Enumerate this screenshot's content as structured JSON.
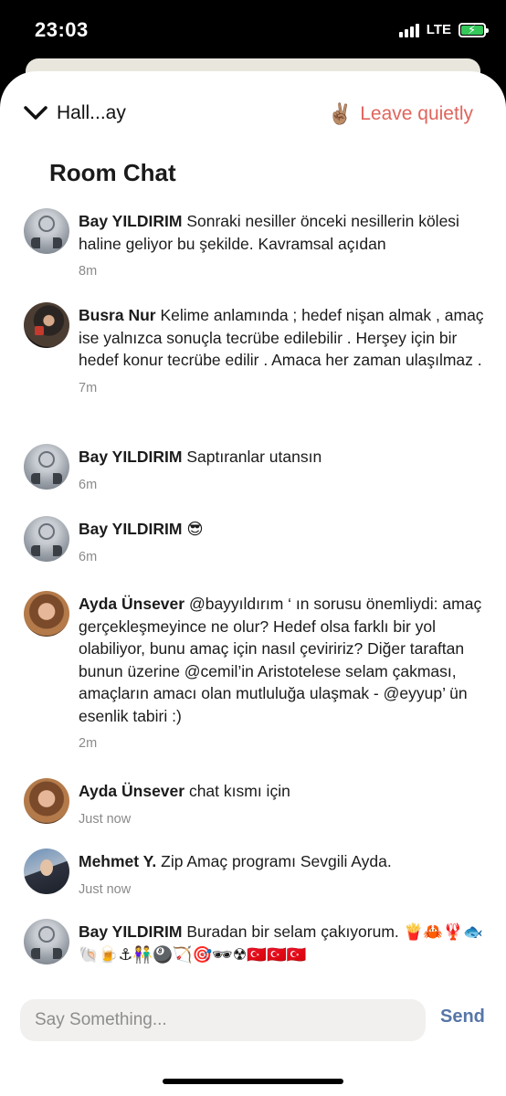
{
  "status_bar": {
    "time": "23:03",
    "network": "LTE",
    "signal_bars": 4,
    "battery_charging": true,
    "battery_color": "#34c759"
  },
  "header": {
    "room_name_short": "Hall...ay",
    "leave_emoji": "✌🏽",
    "leave_label": "Leave quietly",
    "leave_color": "#e0645c"
  },
  "room_title": "Room Chat",
  "messages": [
    {
      "author": "Bay YILDIRIM",
      "text": "Sonraki nesiller önceki nesillerin kölesi haline geliyor bu şekilde. Kavramsal açıdan",
      "time": "8m",
      "avatar": "peace-symbol-avatar"
    },
    {
      "author": "Busra Nur",
      "text": "Kelime anlamında ; hedef nişan almak , amaç ise yalnızca sonuçla tecrübe edilebilir . Herşey için bir hedef konur tecrübe edilir . Amaca her zaman ulaşılmaz .",
      "time": "7m",
      "avatar": "person-photo-avatar"
    },
    {
      "author": "Bay YILDIRIM",
      "text": "Saptıranlar utansın",
      "time": "6m",
      "avatar": "peace-symbol-avatar"
    },
    {
      "author": "Bay YILDIRIM",
      "text": "😎",
      "time": "6m",
      "avatar": "peace-symbol-avatar"
    },
    {
      "author": "Ayda Ünsever",
      "text": "@bayyıldırım ‘ ın sorusu önemliydi: amaç gerçekleşmeyince ne olur? Hedef olsa farklı bir yol olabiliyor, bunu amaç için nasıl çeviririz? Diğer taraftan bunun üzerine @cemil’in  Aristotelese selam çakması, amaçların amacı olan mutluluğa ulaşmak - @eyyup’ ün esenlik tabiri :)",
      "time": "2m",
      "avatar": "person-photo-avatar"
    },
    {
      "author": "Ayda Ünsever",
      "text": "chat kısmı için",
      "time": "Just now",
      "avatar": "person-photo-avatar"
    },
    {
      "author": "Mehmet Y.",
      "text": "Zip Amaç programı Sevgili Ayda.",
      "time": "Just now",
      "avatar": "person-photo-avatar"
    },
    {
      "author": "Bay YILDIRIM",
      "text": "Buradan bir selam çakıyorum. 🍟🦀🦞🐟🐚🍺⚓👫🎱🏹🎯🕶☢🇹🇷🇹🇷🇹🇷",
      "time": "",
      "avatar": "peace-symbol-avatar"
    }
  ],
  "composer": {
    "placeholder": "Say Something...",
    "send_label": "Send",
    "send_color": "#5676a8"
  }
}
